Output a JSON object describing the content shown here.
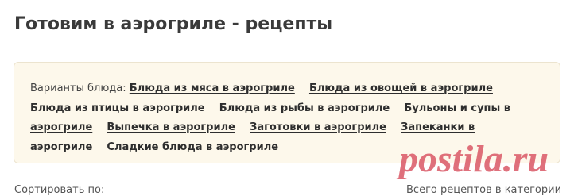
{
  "header": {
    "title": "Готовим в аэрогриле - рецепты"
  },
  "variants": {
    "label": "Варианты блюда:",
    "links": [
      "Блюда из мяса в аэрогриле",
      "Блюда из овощей в аэрогриле",
      "Блюда из птицы в аэрогриле",
      "Блюда из рыбы в аэрогриле",
      "Бульоны и супы в аэрогриле",
      "Выпечка в аэрогриле",
      "Заготовки в аэрогриле",
      "Запеканки в аэрогриле",
      "Сладкие блюда в аэрогриле"
    ]
  },
  "toolbar": {
    "sort_label": "Сортировать по:",
    "recipe_count_label": "Всего рецептов в категории"
  },
  "watermark": {
    "text": "postila.ru",
    "color": "#d8505f"
  },
  "colors": {
    "box_background": "#fdf8eb",
    "box_border": "#ece4cf",
    "link_color": "#2e2e2e",
    "title_color": "#3a3a3a"
  }
}
